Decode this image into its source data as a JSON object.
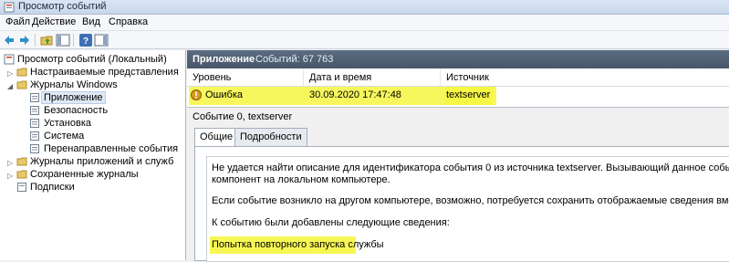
{
  "window": {
    "title": "Просмотр событий"
  },
  "menu": [
    "Файл",
    "Действие",
    "Вид",
    "Справка"
  ],
  "tree": {
    "root": "Просмотр событий (Локальный)",
    "custom_views": "Настраиваемые представления",
    "windows_logs": "Журналы Windows",
    "application": "Приложение",
    "security": "Безопасность",
    "setup": "Установка",
    "system": "Система",
    "forwarded": "Перенаправленные события",
    "app_service_logs": "Журналы приложений и служб",
    "saved_logs": "Сохраненные журналы",
    "subscriptions": "Подписки"
  },
  "log": {
    "name": "Приложение",
    "count_text": "Событий: 67 763",
    "columns": [
      "Уровень",
      "Дата и время",
      "Источник"
    ],
    "rows": [
      {
        "level": "Ошибка",
        "datetime": "30.09.2020 17:47:48",
        "source": "textserver"
      }
    ]
  },
  "detail": {
    "title": "Событие 0, textserver",
    "tabs": [
      "Общие",
      "Подробности"
    ],
    "lines": [
      "Не удается найти описание для идентификатора события 0 из источника textserver. Вызывающий данное событие компонент не устан",
      "компонент на локальном компьютере.",
      "Если событие возникло на другом компьютере, возможно, потребуется сохранить отображаемые сведения вместе с событием.",
      "К событию были добавлены следующие сведения:",
      "Попытка повторного запуска службы"
    ]
  },
  "colors": {
    "highlight": "#f6f641",
    "header_bg": "#4f5f73",
    "error": "#d99a1c"
  }
}
